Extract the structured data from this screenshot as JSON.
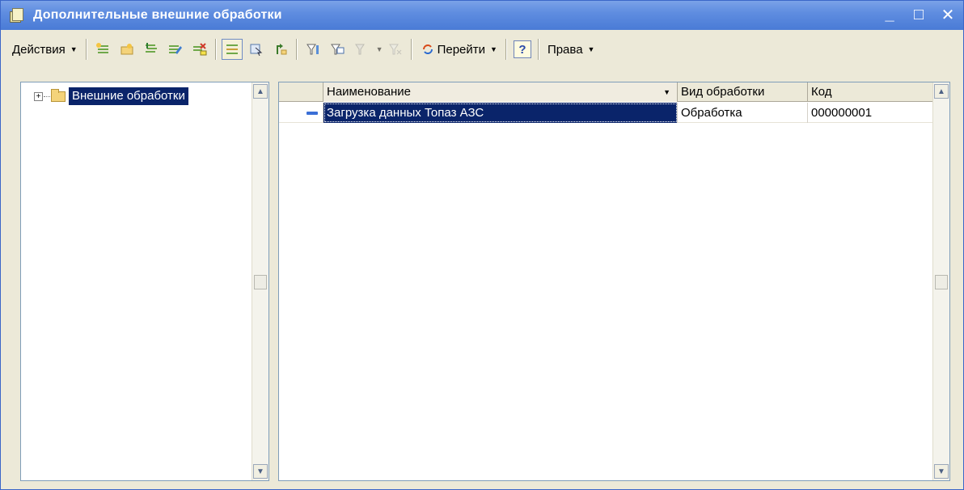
{
  "window": {
    "title": "Дополнительные внешние обработки",
    "minimize": "_",
    "maximize": "□",
    "close": "✕"
  },
  "toolbar": {
    "actions_label": "Действия",
    "goto_label": "Перейти",
    "help_label": "?",
    "rights_label": "Права"
  },
  "tree": {
    "expander": "+",
    "root_label": "Внешние обработки"
  },
  "grid": {
    "columns": [
      "Наименование",
      "Вид обработки",
      "Код"
    ],
    "rows": [
      {
        "name": "Загрузка данных Топаз АЗС",
        "kind": "Обработка",
        "code": "000000001"
      }
    ]
  },
  "icons": {
    "title": "processing-window-icon",
    "tree": "folder-icon",
    "row": "item-marker-icon"
  },
  "colors": {
    "titlebar": "#4a7bd6",
    "selection": "#0a246a",
    "window_bg": "#ece9d8"
  }
}
